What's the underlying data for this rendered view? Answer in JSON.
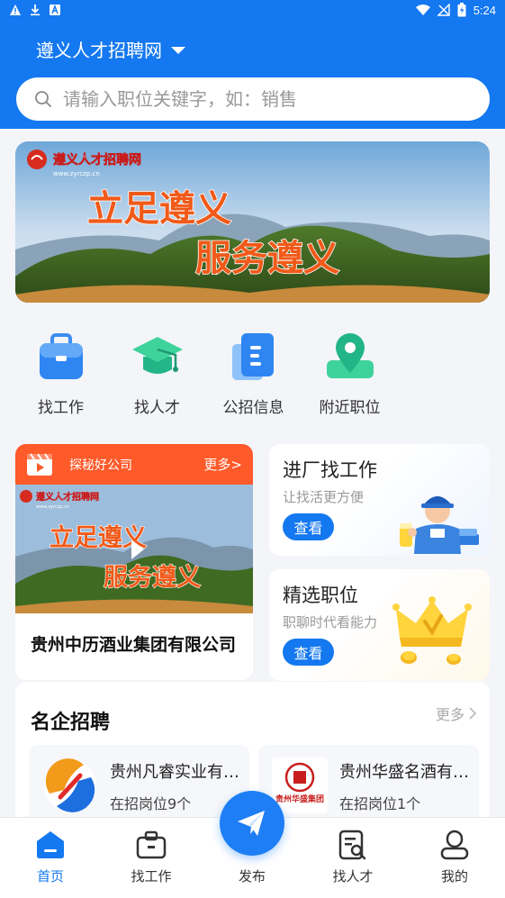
{
  "status_bar": {
    "time": "5:24"
  },
  "header": {
    "city": "遵义人才招聘网",
    "search_placeholder": "请输入职位关键字，如：销售"
  },
  "banner": {
    "logo_text": "遵义人才招聘网",
    "url_text": "www.zyrczp.cn",
    "line1": "立足遵义",
    "line2": "服务遵义"
  },
  "quick_nav": [
    {
      "label": "找工作",
      "icon": "briefcase-icon"
    },
    {
      "label": "找人才",
      "icon": "graduation-cap-icon"
    },
    {
      "label": "公招信息",
      "icon": "document-icon"
    },
    {
      "label": "附近职位",
      "icon": "location-pin-icon"
    }
  ],
  "video_card": {
    "header_label": "探秘好公司",
    "more": "更多>",
    "thumb_logo": "遵义人才招聘网",
    "thumb_url": "www.zyrczp.cn",
    "thumb_line1": "立足遵义",
    "thumb_line2": "服务遵义",
    "company": "贵州中历酒业集团有限公司"
  },
  "side_cards": [
    {
      "title": "进厂找工作",
      "subtitle": "让找活更方便",
      "button": "查看"
    },
    {
      "title": "精选职位",
      "subtitle": "职聊时代看能力",
      "button": "查看"
    }
  ],
  "famous": {
    "title": "名企招聘",
    "more": "更多",
    "companies": [
      {
        "name": "贵州凡睿实业有限公司",
        "count": "在招岗位9个"
      },
      {
        "name": "贵州华盛名酒有限公司",
        "count": "在招岗位1个",
        "logo_text": "贵州华盛集团"
      }
    ]
  },
  "tabbar": {
    "home": "首页",
    "find_job": "找工作",
    "publish": "发布",
    "find_talent": "找人才",
    "mine": "我的"
  },
  "colors": {
    "primary": "#1478f0",
    "orange": "#ff5a2a"
  }
}
